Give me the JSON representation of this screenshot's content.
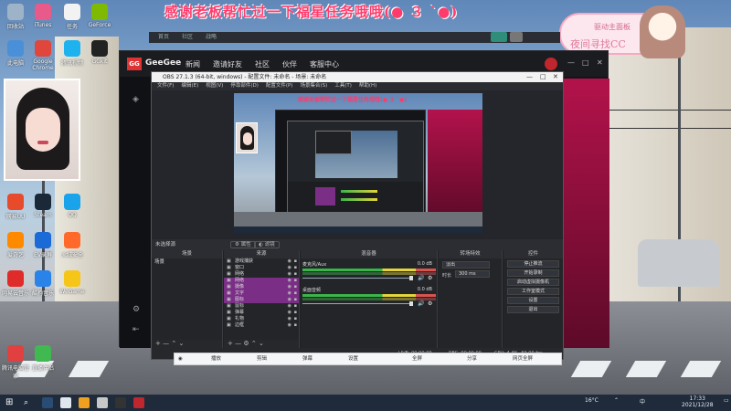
{
  "banner": {
    "text": "感谢老板帮忙过一下福星任务哦哦(● ３ `●)"
  },
  "badge": {
    "line1": "驱动主面板",
    "line2": "夜间寻找CC"
  },
  "desktop_icons": [
    {
      "label": "回收站",
      "color": "#9fb3c8"
    },
    {
      "label": "iTunes",
      "color": "#e85a8a"
    },
    {
      "label": "任务",
      "color": "#f2f2f2"
    },
    {
      "label": "GeForce",
      "color": "#7fba00"
    },
    {
      "label": "此电脑",
      "color": "#4a90d9"
    },
    {
      "label": "Google Chrome",
      "color": "#e0463c"
    },
    {
      "label": "腾讯视频",
      "color": "#1eb2ef"
    },
    {
      "label": "GGkit",
      "color": "#222"
    },
    {
      "label": "网易UU",
      "color": "#e84a2c"
    },
    {
      "label": "Steam",
      "color": "#1b2838"
    },
    {
      "label": "QQ",
      "color": "#18a3ea"
    },
    {
      "label": "爱奇艺",
      "color": "#ff8a00"
    },
    {
      "label": "EV录屏",
      "color": "#1a6ad8"
    },
    {
      "label": "火绒安全",
      "color": "#ff6a2b"
    },
    {
      "label": "网易云音乐",
      "color": "#e02b2b"
    },
    {
      "label": "酷狗音乐",
      "color": "#2a83e8"
    },
    {
      "label": "WeGame",
      "color": "#f5c518"
    },
    {
      "label": "腾讯电脑管家",
      "color": "#e04040"
    },
    {
      "label": "直播伴侣",
      "color": "#3fb950"
    }
  ],
  "geegee": {
    "logo": "GG",
    "name": "GeeGee",
    "nav": [
      "新闻",
      "邀请好友",
      "社区",
      "伙伴",
      "客服中心"
    ]
  },
  "back_nav": [
    "首页",
    "社区",
    "战略"
  ],
  "obs": {
    "title": "OBS 27.1.3 (64-bit, windows) - 配置文件: 未命名 - 场景: 未命名",
    "menu": [
      "文件(F)",
      "编辑(E)",
      "视图(V)",
      "停靠部件(D)",
      "配置文件(P)",
      "场景集合(S)",
      "工具(T)",
      "帮助(H)"
    ],
    "source_bar_label": "未选择源",
    "properties_label": "属性",
    "filters_label": "滤镜",
    "docks": {
      "scenes": {
        "title": "场景",
        "items": [
          "场景"
        ]
      },
      "sources": {
        "title": "来源",
        "items": [
          {
            "name": "游戏捕获",
            "highlighted": false
          },
          {
            "name": "窗口",
            "highlighted": false
          },
          {
            "name": "网络",
            "highlighted": false
          },
          {
            "name": "网络",
            "highlighted": true
          },
          {
            "name": "摄像",
            "highlighted": true
          },
          {
            "name": "文字",
            "highlighted": true
          },
          {
            "name": "图标",
            "highlighted": true
          },
          {
            "name": "鼠标",
            "highlighted": false
          },
          {
            "name": "弹幕",
            "highlighted": false
          },
          {
            "name": "礼物",
            "highlighted": false
          },
          {
            "name": "边框",
            "highlighted": false
          }
        ]
      },
      "mixer": {
        "title": "混音器",
        "channels": [
          {
            "name": "麦克风/Aux",
            "db": "0.0 dB"
          },
          {
            "name": "桌面音频",
            "db": "0.0 dB"
          }
        ]
      },
      "transitions": {
        "title": "转场特效",
        "type": "淡出",
        "duration_label": "时长",
        "duration": "300 ms"
      },
      "controls": {
        "title": "控件",
        "buttons": [
          "停止推流",
          "开始录制",
          "启动虚拟摄像机",
          "工作室模式",
          "设置",
          "退出"
        ]
      }
    },
    "status": {
      "live": "LIVE: 00:00:00",
      "rec": "REC: 00:00:00",
      "cpu": "CPU: 4.4%, 60.00 fps"
    }
  },
  "player": {
    "items": [
      "播放",
      "剪辑",
      "弹幕",
      "设置",
      "全屏",
      "分享",
      "网页全屏"
    ]
  },
  "taskbar": {
    "weather": "16°C",
    "lang": "中",
    "time": "17:33",
    "date": "2021/12/28"
  }
}
